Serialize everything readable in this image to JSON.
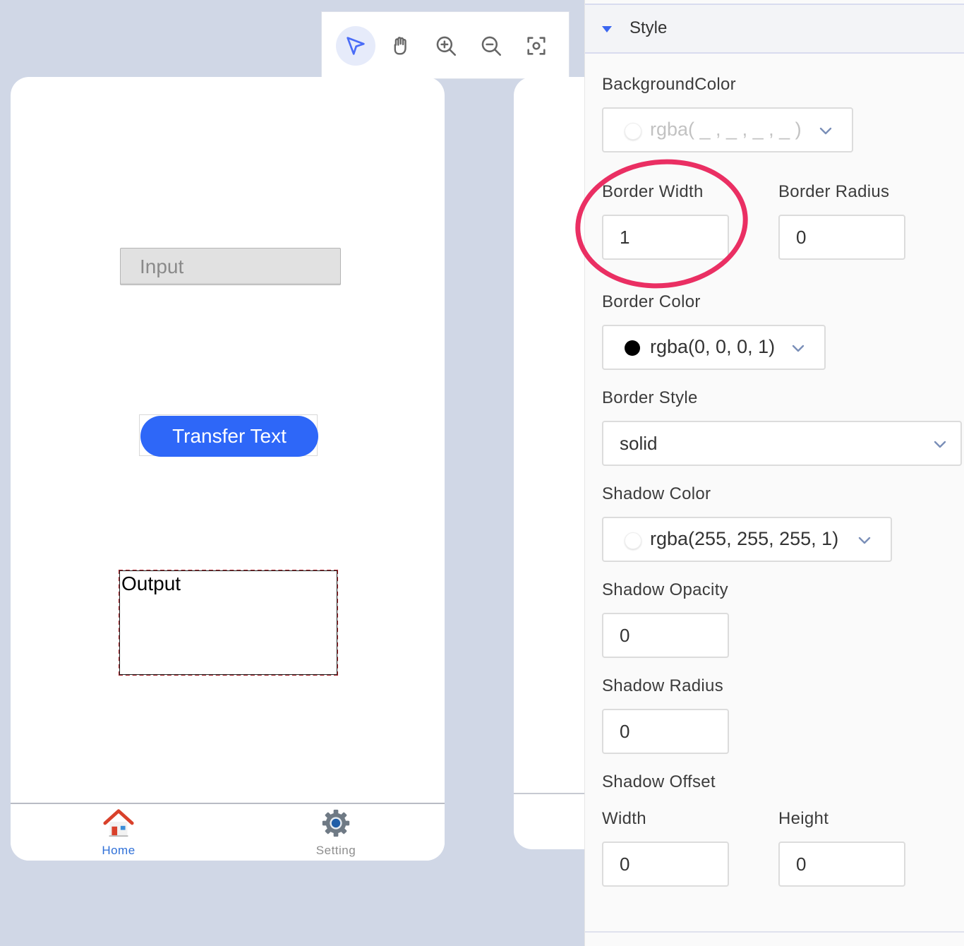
{
  "toolbar": {
    "tools": [
      {
        "icon": "pointer-icon",
        "active": true
      },
      {
        "icon": "hand-icon",
        "active": false
      },
      {
        "icon": "zoom-in-icon",
        "active": false
      },
      {
        "icon": "zoom-out-icon",
        "active": false
      },
      {
        "icon": "fit-screen-icon",
        "active": false
      }
    ],
    "accent": "#4a6cf7"
  },
  "canvas": {
    "input_placeholder": "Input",
    "transfer_button_label": "Transfer Text",
    "output_label": "Output",
    "tabs": [
      {
        "label": "Home",
        "icon": "home-icon",
        "active": true
      },
      {
        "label": "Setting",
        "icon": "gear-icon",
        "active": false
      }
    ]
  },
  "panel": {
    "section_title": "Style",
    "background_color": {
      "label": "BackgroundColor",
      "value": "rgba( _ , _ , _ , _ )",
      "dot": "#ffffff"
    },
    "border_width": {
      "label": "Border Width",
      "value": "1"
    },
    "border_radius": {
      "label": "Border Radius",
      "value": "0"
    },
    "border_color": {
      "label": "Border Color",
      "value": "rgba(0, 0, 0, 1)",
      "dot": "#000000"
    },
    "border_style": {
      "label": "Border Style",
      "value": "solid"
    },
    "shadow_color": {
      "label": "Shadow Color",
      "value": "rgba(255, 255, 255, 1)",
      "dot": "#ffffff"
    },
    "shadow_opacity": {
      "label": "Shadow Opacity",
      "value": "0"
    },
    "shadow_radius": {
      "label": "Shadow Radius",
      "value": "0"
    },
    "shadow_offset": {
      "label": "Shadow Offset",
      "width_label": "Width",
      "width_value": "0",
      "height_label": "Height",
      "height_value": "0"
    }
  },
  "colors": {
    "primary_button": "#2e67f8",
    "annotation_circle": "#ea2f63",
    "tab_active": "#2f70d8"
  }
}
